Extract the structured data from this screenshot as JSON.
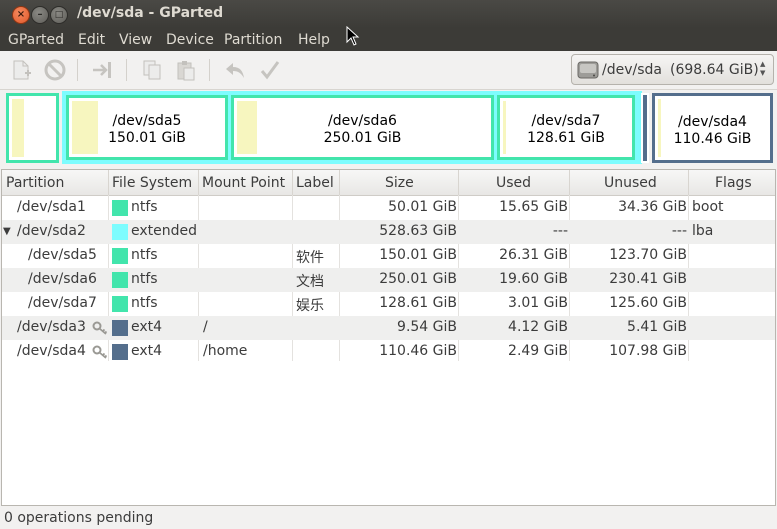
{
  "window": {
    "title": "/dev/sda - GParted",
    "close_glyph": "×",
    "min_glyph": "–",
    "max_glyph": "□"
  },
  "menu": [
    "GParted",
    "Edit",
    "View",
    "Device",
    "Partition",
    "Help"
  ],
  "toolbar": {
    "icons": [
      "new-partition-icon",
      "delete-icon",
      "resize-move-icon",
      "copy-icon",
      "paste-icon",
      "undo-icon",
      "apply-icon"
    ]
  },
  "device": {
    "name": "/dev/sda",
    "size": "(698.64 GiB)",
    "arrow_up": "▲",
    "arrow_down": "▼"
  },
  "disk_map": [
    {
      "name": "/dev/sda5",
      "size": "150.01 GiB",
      "used_fraction": 0.175
    },
    {
      "name": "/dev/sda6",
      "size": "250.01 GiB",
      "used_fraction": 0.078
    },
    {
      "name": "/dev/sda7",
      "size": "128.61 GiB",
      "used_fraction": 0.023
    },
    {
      "name": "/dev/sda4",
      "size": "110.46 GiB",
      "used_fraction": 0.023
    }
  ],
  "table": {
    "headers": [
      "Partition",
      "File System",
      "Mount Point",
      "Label",
      "Size",
      "Used",
      "Unused",
      "Flags"
    ],
    "rows": [
      {
        "partition": "/dev/sda1",
        "fs": "ntfs",
        "fs_color": "#42e5ac",
        "mount": "",
        "label": "",
        "size": "50.01 GiB",
        "used": "15.65 GiB",
        "unused": "34.36 GiB",
        "flags": "boot",
        "indent": 1,
        "expander": "",
        "key": false
      },
      {
        "partition": "/dev/sda2",
        "fs": "extended",
        "fs_color": "#7dfcfe",
        "mount": "",
        "label": "",
        "size": "528.63 GiB",
        "used": "---",
        "unused": "---",
        "flags": "lba",
        "indent": 1,
        "expander": "▼",
        "key": false
      },
      {
        "partition": "/dev/sda5",
        "fs": "ntfs",
        "fs_color": "#42e5ac",
        "mount": "",
        "label": "软件",
        "size": "150.01 GiB",
        "used": "26.31 GiB",
        "unused": "123.70 GiB",
        "flags": "",
        "indent": 2,
        "expander": "",
        "key": false
      },
      {
        "partition": "/dev/sda6",
        "fs": "ntfs",
        "fs_color": "#42e5ac",
        "mount": "",
        "label": "文档",
        "size": "250.01 GiB",
        "used": "19.60 GiB",
        "unused": "230.41 GiB",
        "flags": "",
        "indent": 2,
        "expander": "",
        "key": false
      },
      {
        "partition": "/dev/sda7",
        "fs": "ntfs",
        "fs_color": "#42e5ac",
        "mount": "",
        "label": "娱乐",
        "size": "128.61 GiB",
        "used": "3.01 GiB",
        "unused": "125.60 GiB",
        "flags": "",
        "indent": 2,
        "expander": "",
        "key": false
      },
      {
        "partition": "/dev/sda3",
        "fs": "ext4",
        "fs_color": "#546e8c",
        "mount": "/",
        "label": "",
        "size": "9.54 GiB",
        "used": "4.12 GiB",
        "unused": "5.41 GiB",
        "flags": "",
        "indent": 1,
        "expander": "",
        "key": true
      },
      {
        "partition": "/dev/sda4",
        "fs": "ext4",
        "fs_color": "#546e8c",
        "mount": "/home",
        "label": "",
        "size": "110.46 GiB",
        "used": "2.49 GiB",
        "unused": "107.98 GiB",
        "flags": "",
        "indent": 1,
        "expander": "",
        "key": true
      }
    ]
  },
  "status": "0 operations pending",
  "colors": {
    "ntfs": "#42e5ac",
    "extended": "#7dfcfe",
    "ext4": "#546e8c",
    "used_fill": "#f7f6bf"
  }
}
